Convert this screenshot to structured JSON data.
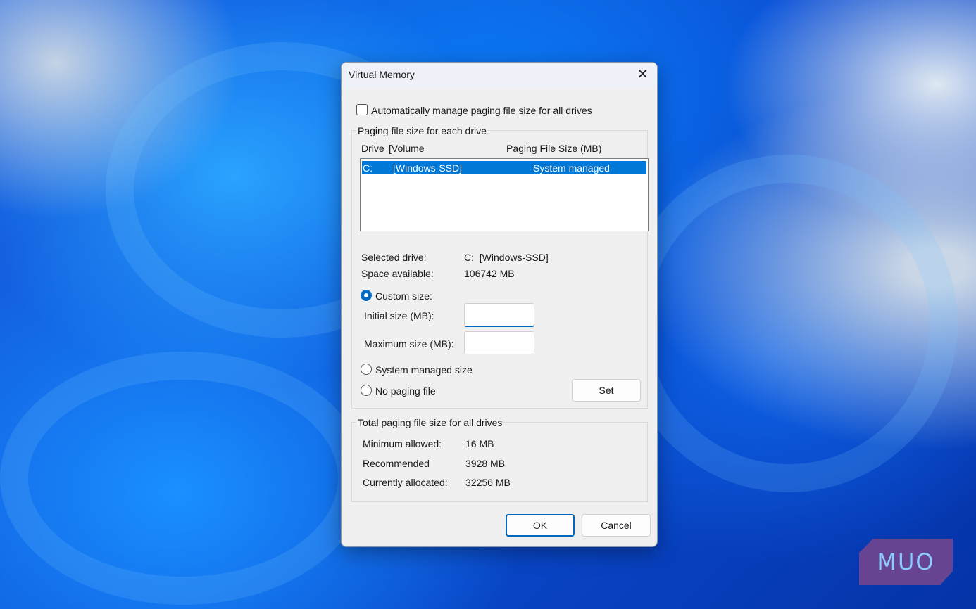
{
  "dialog": {
    "title": "Virtual Memory",
    "close_icon": "close-icon"
  },
  "auto_manage": {
    "label": "Automatically manage paging file size for all drives",
    "checked": false
  },
  "drive_group": {
    "legend": "Paging file size for each drive",
    "headers": {
      "drive": "Drive",
      "volume": "[Volume",
      "size": "Paging File Size (MB)"
    },
    "rows": [
      {
        "drive": "C:",
        "volume": "[Windows-SSD]",
        "size": "System managed",
        "selected": true
      }
    ],
    "selected_drive_label": "Selected drive:",
    "selected_drive_value": "C:  [Windows-SSD]",
    "space_label": "Space available:",
    "space_value": "106742 MB",
    "custom_size": "Custom size:",
    "initial_label": "Initial size (MB):",
    "initial_value": "",
    "max_label": "Maximum size (MB):",
    "max_value": "",
    "system_managed": "System managed size",
    "no_paging": "No paging file",
    "set": "Set"
  },
  "total_group": {
    "legend": "Total paging file size for all drives",
    "min_label": "Minimum allowed:",
    "min_value": "16 MB",
    "rec_label": "Recommended",
    "rec_value": "3928 MB",
    "cur_label": "Currently allocated:",
    "cur_value": "32256 MB"
  },
  "buttons": {
    "ok": "OK",
    "cancel": "Cancel"
  },
  "watermark": "MUO",
  "colors": {
    "accent": "#0078d7"
  }
}
